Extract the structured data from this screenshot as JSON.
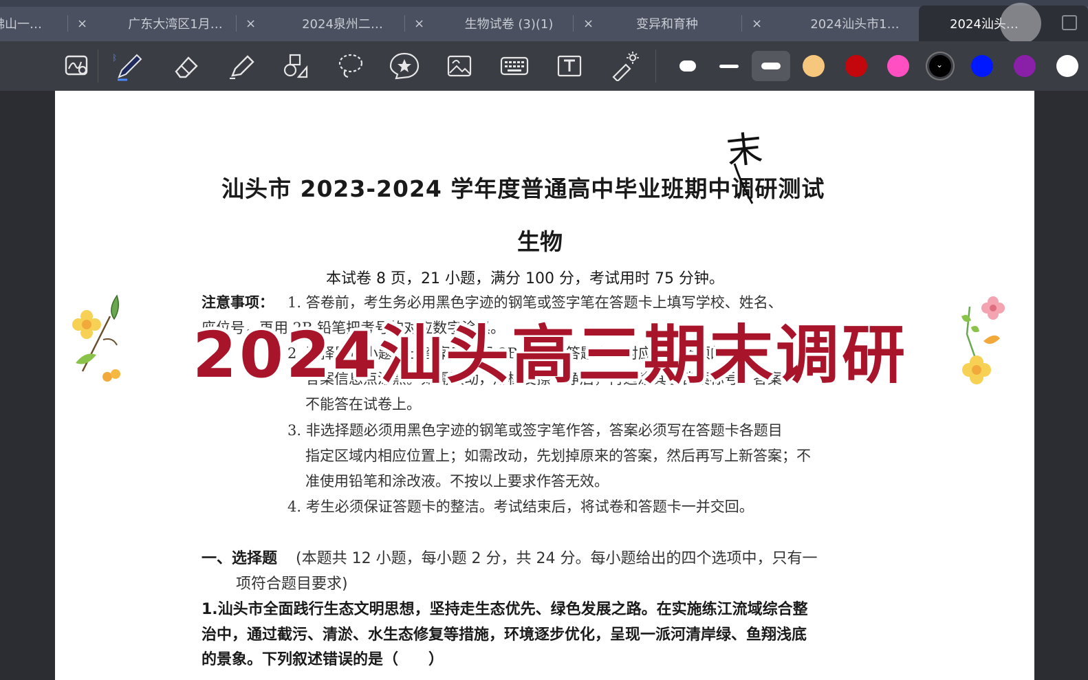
{
  "tabs": [
    {
      "label": "佛山一…",
      "active": false
    },
    {
      "label": "广东大湾区1月…",
      "active": false
    },
    {
      "label": "2024泉州二…",
      "active": false
    },
    {
      "label": "生物试卷 (3)(1)",
      "active": false
    },
    {
      "label": "变异和育种",
      "active": false
    },
    {
      "label": "2024汕头市1…",
      "active": false
    },
    {
      "label": "2024汕头…",
      "active": true
    }
  ],
  "tab_close_glyph": "×",
  "tools": [
    "lasso-zoom-icon",
    "pen-icon",
    "eraser-icon",
    "highlighter-icon",
    "shapes-icon",
    "lasso-icon",
    "sticker-icon",
    "image-icon",
    "keyboard-icon",
    "textbox-icon",
    "laser-pointer-icon"
  ],
  "colors": {
    "swatches": [
      "#ffffff",
      "#ffffff",
      "#ffffff",
      "#f8c77e",
      "#c4060d",
      "#ff4fc0",
      "#000000",
      "#0018ff",
      "#8a1fa8",
      "#ffffff"
    ],
    "banner": "#a8142a",
    "selected_stroke_bg": "#55585f"
  },
  "document": {
    "title": "汕头市 2023-2024 学年度普通高中毕业班期中调研测试",
    "subject": "生物",
    "info": "本试卷 8 页，21 小题，满分 100 分，考试用时 75 分钟。",
    "notice_label": "注意事项：",
    "notice_1a": "1. 答卷前，考生务必用黑色字迹的钢笔或签字笔在答题卡上填写学校、姓名、",
    "notice_1b": "座位号，再用 2B 铅笔把考号的对应数字涂黑。",
    "notice_2a": "2. 选择题每小题选出答案后，用 2B 铅笔把答题卡上对应题目选项的",
    "notice_2b": "答案信息点涂黑。如需改动，用橡皮擦干净后，再选涂其它答案标号。答案",
    "notice_2c": "不能答在试卷上。",
    "notice_3a": "3. 非选择题必须用黑色字迹的钢笔或签字笔作答，答案必须写在答题卡各题目",
    "notice_3b": "指定区域内相应位置上；如需改动，先划掉原来的答案，然后再写上新答案；不",
    "notice_3c": "准使用铅笔和涂改液。不按以上要求作答无效。",
    "notice_4": "4. 考生必须保证答题卡的整洁。考试结束后，将试卷和答题卡一并交回。",
    "section_label": "一、选择题",
    "section_desc_a": "(本题共 12 小题，每小题 2 分，共 24 分。每小题给出的四个选项中，只有一",
    "section_desc_b": "项符合题目要求)",
    "q1_a": "1.汕头市全面践行生态文明思想，坚持走生态优先、绿色发展之路。在实施练江流域综合整",
    "q1_b": "治中，通过截污、清淤、水生态修复等措施，环境逐步优化，呈现一派河清岸绿、鱼翔浅底",
    "q1_c": "的景象。下列叙述错误的是（　　）"
  },
  "handwritten_annotation": "末",
  "overlay_banner": "2024汕头高三期末调研"
}
